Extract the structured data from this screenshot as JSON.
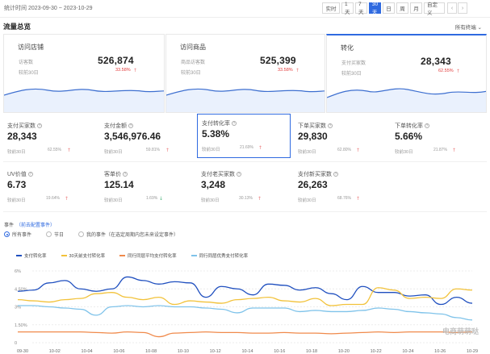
{
  "header": {
    "date_range": "统计时间 2023-09-30 ~ 2023-10-29",
    "periods": [
      "实时",
      "1天",
      "7天",
      "30天",
      "日",
      "周",
      "月",
      "自定义"
    ],
    "active_period": "30天",
    "prev": "‹",
    "next": "›"
  },
  "section": {
    "title": "流量总览",
    "filter": "所有终端 ⌄"
  },
  "top_cards": [
    {
      "title": "访问店铺",
      "sub": "访客数",
      "value": "526,874",
      "cmp": "较前30日",
      "pct": "33.58%",
      "arrow": "🡑"
    },
    {
      "title": "访问商品",
      "sub": "商品访客数",
      "value": "525,399",
      "cmp": "较前30日",
      "pct": "33.58%",
      "arrow": "🡑"
    },
    {
      "title": "转化",
      "sub": "支付买家数",
      "value": "28,343",
      "cmp": "较前30日",
      "pct": "62.55%",
      "arrow": "🡑"
    }
  ],
  "metrics": [
    {
      "title": "支付买家数",
      "value": "28,343",
      "cmp": "较前30日",
      "pct": "62.55%",
      "dir": "up"
    },
    {
      "title": "支付金额",
      "value": "3,546,976.46",
      "cmp": "较前30日",
      "pct": "59.81%",
      "dir": "up"
    },
    {
      "title": "支付转化率",
      "value": "5.38%",
      "cmp": "较前30日",
      "pct": "21.69%",
      "dir": "up"
    },
    {
      "title": "下单买家数",
      "value": "29,830",
      "cmp": "较前30日",
      "pct": "62.80%",
      "dir": "up"
    },
    {
      "title": "下单转化率",
      "value": "5.66%",
      "cmp": "较前30日",
      "pct": "21.87%",
      "dir": "up"
    },
    {
      "title": "UV价值",
      "value": "6.73",
      "cmp": "较前30日",
      "pct": "19.64%",
      "dir": "up"
    },
    {
      "title": "客单价",
      "value": "125.14",
      "cmp": "较前30日",
      "pct": "1.69%",
      "dir": "down"
    },
    {
      "title": "支付老买家数",
      "value": "3,248",
      "cmp": "较前30日",
      "pct": "30.13%",
      "dir": "up"
    },
    {
      "title": "支付新买家数",
      "value": "26,263",
      "cmp": "较前30日",
      "pct": "68.76%",
      "dir": "up"
    }
  ],
  "events": {
    "label": "事件",
    "link": "（前去配置事件）",
    "options": [
      "所有事件",
      "节日",
      "我的事件（在选定周期内您未来设定事件）"
    ]
  },
  "watermark": "电商萌萌哒",
  "colors": {
    "accent": "#2f6ae0",
    "up": "#e23a3a",
    "down": "#18a058",
    "series": [
      "#1f4fbf",
      "#f2c23a",
      "#f08a4b",
      "#7fc3ea"
    ]
  },
  "chart_data": {
    "type": "line",
    "x": [
      "09-30",
      "10-02",
      "10-04",
      "10-06",
      "10-08",
      "10-10",
      "10-12",
      "10-14",
      "10-16",
      "10-18",
      "10-20",
      "10-22",
      "10-24",
      "10-26",
      "10-29"
    ],
    "yticks": [
      "6%",
      "4.50%",
      "3%",
      "1.50%",
      "0"
    ],
    "ylim": [
      0,
      6
    ],
    "series": [
      {
        "name": "支付转化率",
        "color": "#1f4fbf",
        "values": [
          4.3,
          4.4,
          5.0,
          5.2,
          4.5,
          4.3,
          4.5,
          5.5,
          5.2,
          4.9,
          5.1,
          5.0,
          3.8,
          4.7,
          4.5,
          4.0,
          4.9,
          4.8,
          4.4,
          4.6,
          4.1,
          3.6,
          4.7,
          4.2,
          4.2,
          3.9,
          4.0,
          3.2,
          3.8,
          3.3
        ]
      },
      {
        "name": "30天前支付转化率",
        "color": "#f2c23a",
        "values": [
          3.6,
          3.5,
          3.4,
          3.6,
          3.7,
          4.1,
          4.2,
          3.8,
          3.6,
          3.8,
          3.2,
          3.5,
          3.4,
          3.3,
          3.6,
          3.7,
          3.8,
          3.5,
          3.4,
          3.7,
          3.1,
          3.2,
          3.2,
          4.6,
          4.4,
          3.7,
          3.8,
          3.7,
          4.5,
          4.4
        ]
      },
      {
        "name": "同行同层平均支付转化率",
        "color": "#f08a4b",
        "values": [
          0.9,
          0.9,
          0.9,
          0.9,
          0.9,
          0.85,
          0.8,
          0.9,
          0.85,
          0.5,
          0.8,
          0.85,
          0.9,
          0.85,
          0.85,
          0.8,
          0.8,
          0.85,
          0.8,
          0.8,
          0.75,
          0.8,
          0.85,
          0.9,
          0.85,
          0.9,
          0.9,
          0.9,
          0.85,
          0.9
        ]
      },
      {
        "name": "同行同层优秀支付转化率",
        "color": "#7fc3ea",
        "values": [
          3.1,
          3.1,
          3.0,
          2.9,
          2.8,
          2.3,
          3.0,
          3.1,
          3.0,
          3.1,
          3.0,
          3.0,
          2.9,
          2.8,
          2.5,
          2.9,
          2.9,
          2.9,
          2.6,
          2.7,
          2.6,
          2.6,
          2.7,
          2.9,
          2.8,
          2.6,
          2.5,
          2.4,
          2.1,
          1.9
        ]
      }
    ]
  }
}
